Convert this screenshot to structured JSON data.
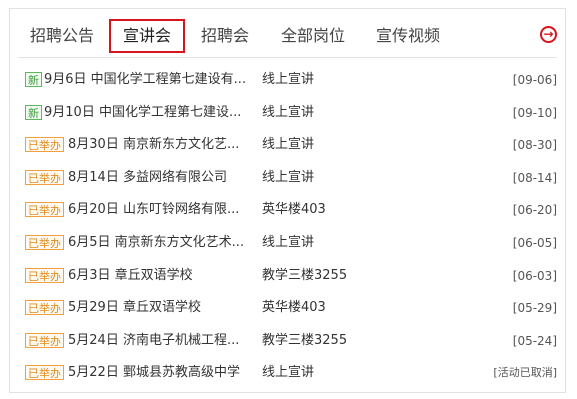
{
  "tabs": [
    {
      "label": "招聘公告",
      "active": false
    },
    {
      "label": "宣讲会",
      "active": true
    },
    {
      "label": "招聘会",
      "active": false
    },
    {
      "label": "全部岗位",
      "active": false
    },
    {
      "label": "宣传视频",
      "active": false
    }
  ],
  "more_icon": "arrow-right-circle-icon",
  "more_glyph": "→",
  "colors": {
    "accent": "#d6151d",
    "new_badge": "#5cb85c",
    "done_badge": "#f0a040"
  },
  "items": [
    {
      "badge": "新",
      "status": "new",
      "title": "9月6日 中国化学工程第七建设有...",
      "place": "线上宣讲",
      "date": "[09-06]"
    },
    {
      "badge": "新",
      "status": "new",
      "title": "9月10日 中国化学工程第七建设...",
      "place": "线上宣讲",
      "date": "[09-10]"
    },
    {
      "badge": "已举办",
      "status": "done",
      "title": "8月30日 南京新东方文化艺...",
      "place": "线上宣讲",
      "date": "[08-30]"
    },
    {
      "badge": "已举办",
      "status": "done",
      "title": "8月14日 多益网络有限公司",
      "place": "线上宣讲",
      "date": "[08-14]"
    },
    {
      "badge": "已举办",
      "status": "done",
      "title": "6月20日 山东叮铃网络有限...",
      "place": "英华楼403",
      "date": "[06-20]"
    },
    {
      "badge": "已举办",
      "status": "done",
      "title": "6月5日 南京新东方文化艺术...",
      "place": "线上宣讲",
      "date": "[06-05]"
    },
    {
      "badge": "已举办",
      "status": "done",
      "title": "6月3日 章丘双语学校",
      "place": "教学三楼3255",
      "date": "[06-03]"
    },
    {
      "badge": "已举办",
      "status": "done",
      "title": "5月29日 章丘双语学校",
      "place": "英华楼403",
      "date": "[05-29]"
    },
    {
      "badge": "已举办",
      "status": "done",
      "title": "5月24日 济南电子机械工程...",
      "place": "教学三楼3255",
      "date": "[05-24]"
    },
    {
      "badge": "已举办",
      "status": "done",
      "title": "5月22日 鄄城县苏教高级中学",
      "place": "线上宣讲",
      "date": "[活动已取消]"
    }
  ]
}
